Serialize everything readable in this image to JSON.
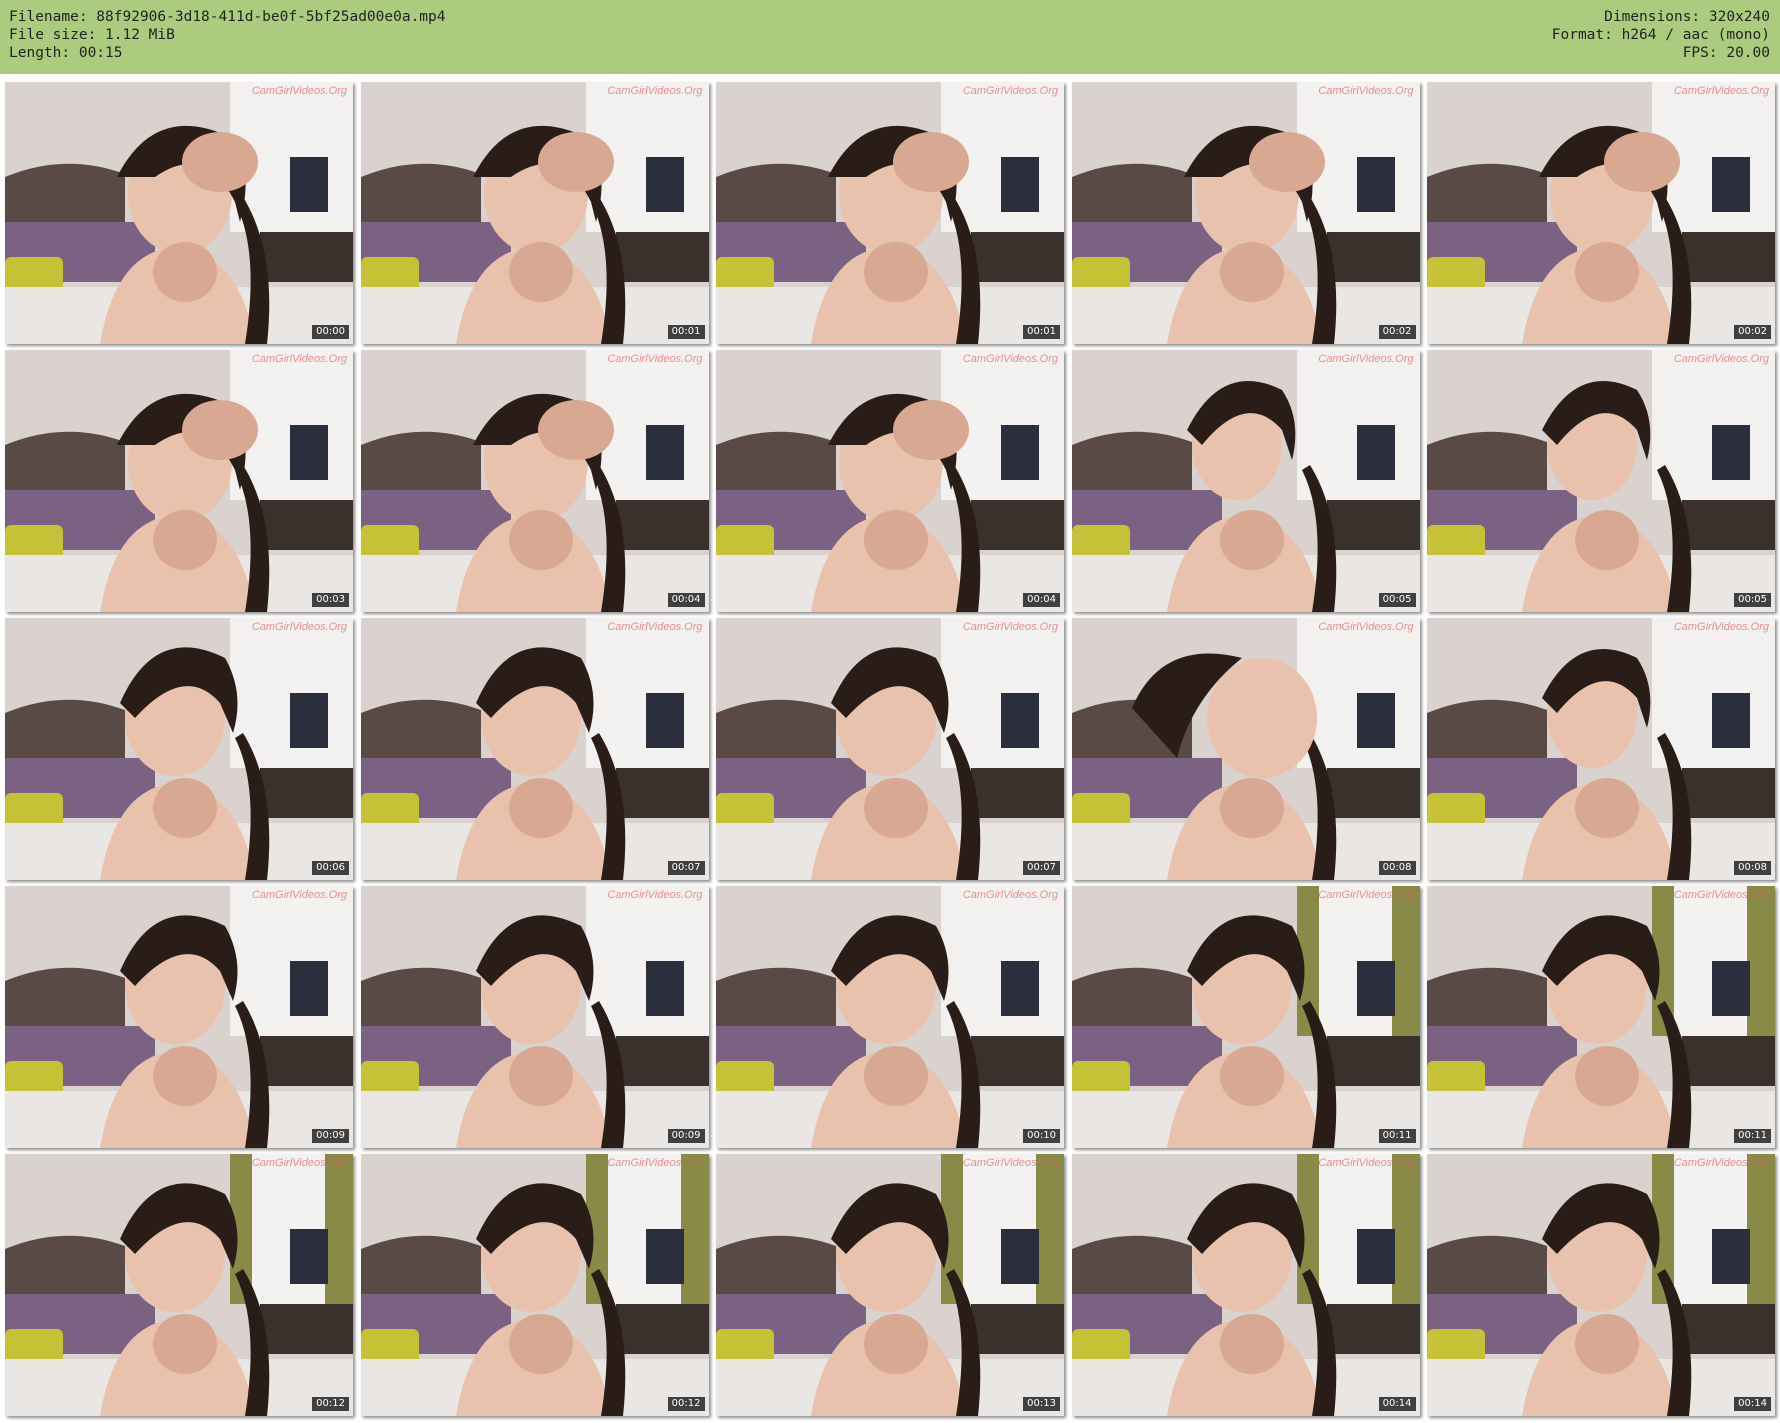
{
  "header": {
    "left": [
      "Filename: 88f92906-3d18-411d-be0f-5bf25ad00e0a.mp4",
      "File size: 1.12 MiB",
      "Length: 00:15"
    ],
    "right": [
      "Dimensions: 320x240",
      "Format: h264 / aac (mono)",
      "FPS: 20.00"
    ]
  },
  "watermark": "CamGirlVideos.Org",
  "frames": [
    "00:00",
    "00:01",
    "00:01",
    "00:02",
    "00:02",
    "00:03",
    "00:04",
    "00:04",
    "00:05",
    "00:05",
    "00:06",
    "00:07",
    "00:07",
    "00:08",
    "00:08",
    "00:09",
    "00:09",
    "00:10",
    "00:11",
    "00:11",
    "00:12",
    "00:12",
    "00:13",
    "00:14",
    "00:14"
  ]
}
